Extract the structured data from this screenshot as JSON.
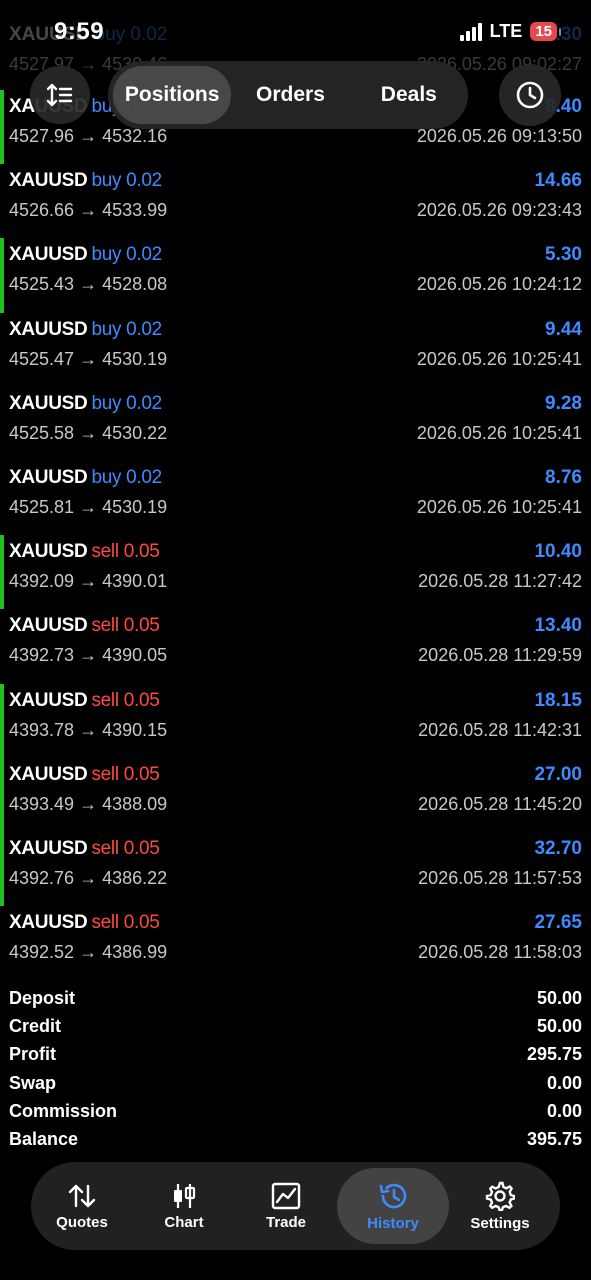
{
  "status_bar": {
    "time": "9:59",
    "network": "LTE",
    "battery": "15"
  },
  "ghost_row": {
    "symbol": "XAUUSD",
    "action": "buy 0.02",
    "prices": "4527.97 → 4530.46",
    "profit": "8.30",
    "date": "2026.05.26 09:02:27"
  },
  "header": {
    "tabs": [
      {
        "label": "Positions"
      },
      {
        "label": "Orders"
      },
      {
        "label": "Deals"
      }
    ]
  },
  "deals": [
    {
      "symbol": "XAUUSD",
      "side": "buy",
      "volume": "0.02",
      "prices": "4527.96 → 4532.16",
      "profit": "8.40",
      "date": "2026.05.26 09:13:50",
      "marked": true
    },
    {
      "symbol": "XAUUSD",
      "side": "buy",
      "volume": "0.02",
      "prices": "4526.66 → 4533.99",
      "profit": "14.66",
      "date": "2026.05.26 09:23:43",
      "marked": false
    },
    {
      "symbol": "XAUUSD",
      "side": "buy",
      "volume": "0.02",
      "prices": "4525.43 → 4528.08",
      "profit": "5.30",
      "date": "2026.05.26 10:24:12",
      "marked": true
    },
    {
      "symbol": "XAUUSD",
      "side": "buy",
      "volume": "0.02",
      "prices": "4525.47 → 4530.19",
      "profit": "9.44",
      "date": "2026.05.26 10:25:41",
      "marked": false
    },
    {
      "symbol": "XAUUSD",
      "side": "buy",
      "volume": "0.02",
      "prices": "4525.58 → 4530.22",
      "profit": "9.28",
      "date": "2026.05.26 10:25:41",
      "marked": false
    },
    {
      "symbol": "XAUUSD",
      "side": "buy",
      "volume": "0.02",
      "prices": "4525.81 → 4530.19",
      "profit": "8.76",
      "date": "2026.05.26 10:25:41",
      "marked": false
    },
    {
      "symbol": "XAUUSD",
      "side": "sell",
      "volume": "0.05",
      "prices": "4392.09 → 4390.01",
      "profit": "10.40",
      "date": "2026.05.28 11:27:42",
      "marked": true
    },
    {
      "symbol": "XAUUSD",
      "side": "sell",
      "volume": "0.05",
      "prices": "4392.73 → 4390.05",
      "profit": "13.40",
      "date": "2026.05.28 11:29:59",
      "marked": false
    },
    {
      "symbol": "XAUUSD",
      "side": "sell",
      "volume": "0.05",
      "prices": "4393.78 → 4390.15",
      "profit": "18.15",
      "date": "2026.05.28 11:42:31",
      "marked": true
    },
    {
      "symbol": "XAUUSD",
      "side": "sell",
      "volume": "0.05",
      "prices": "4393.49 → 4388.09",
      "profit": "27.00",
      "date": "2026.05.28 11:45:20",
      "marked": true
    },
    {
      "symbol": "XAUUSD",
      "side": "sell",
      "volume": "0.05",
      "prices": "4392.76 → 4386.22",
      "profit": "32.70",
      "date": "2026.05.28 11:57:53",
      "marked": true
    },
    {
      "symbol": "XAUUSD",
      "side": "sell",
      "volume": "0.05",
      "prices": "4392.52 → 4386.99",
      "profit": "27.65",
      "date": "2026.05.28 11:58:03",
      "marked": false
    }
  ],
  "summary": [
    {
      "label": "Deposit",
      "value": "50.00"
    },
    {
      "label": "Credit",
      "value": "50.00"
    },
    {
      "label": "Profit",
      "value": "295.75"
    },
    {
      "label": "Swap",
      "value": "0.00"
    },
    {
      "label": "Commission",
      "value": "0.00"
    },
    {
      "label": "Balance",
      "value": "395.75"
    }
  ],
  "bottom_nav": [
    {
      "label": "Quotes",
      "icon": "quotes-icon"
    },
    {
      "label": "Chart",
      "icon": "chart-icon"
    },
    {
      "label": "Trade",
      "icon": "trade-icon"
    },
    {
      "label": "History",
      "icon": "history-icon",
      "active": true
    },
    {
      "label": "Settings",
      "icon": "gear-icon"
    }
  ],
  "colors": {
    "buy": "#3d8bff",
    "sell": "#ff4a3d",
    "profit": "#3d8bff",
    "marker": "#20c020"
  }
}
